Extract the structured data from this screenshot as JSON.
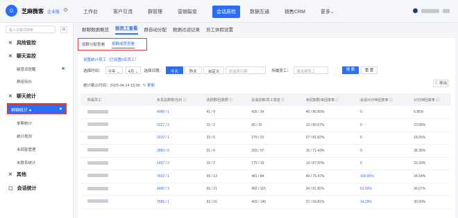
{
  "header": {
    "brand": "芝麻微客",
    "brand_tag": "企业版",
    "nav": [
      "工作台",
      "客户引流",
      "群管理",
      "营销裂变",
      "会话质检",
      "数据互通",
      "销售CRM",
      "更多⌄"
    ],
    "active_nav_index": 4
  },
  "sidebar": {
    "search_placeholder": "输入关键词搜索",
    "collapse": "⊟",
    "sections": [
      {
        "icon": "✕",
        "label": "风险管控",
        "caret": "⌄"
      },
      {
        "icon": "✕",
        "label": "聊天监控",
        "caret": "⌃"
      },
      {
        "icon": "✕",
        "label": "聊天统计",
        "caret": "⌃"
      },
      {
        "icon": "✕",
        "label": "其他",
        "caret": "⌄"
      },
      {
        "icon": "▢",
        "label": "会话统计",
        "caret": ""
      }
    ],
    "sub_items": [
      "敏感词提醒",
      "群组待办",
      "群聊统计",
      "单聊统计",
      "统计规则",
      "未回复管理",
      "未联系统计"
    ],
    "active_item": "群聊统计"
  },
  "main": {
    "page_tabs": [
      "群聊数据概览",
      "按员工查看",
      "群自动分配",
      "数据过滤记录",
      "员工休假设置"
    ],
    "active_page_tab": 1,
    "sub_tabs": [
      "按群分配查看",
      "按群成员查看"
    ],
    "active_sub_tab": 1,
    "setting_link": "设置统计员工（已设置0名员工）",
    "filter": {
      "time_label": "选择时间：",
      "year": "今年 ⌄",
      "month": "4月 ⌄",
      "date_label": "选择日期：",
      "date_options": [
        "今天",
        "昨天",
        "自定义"
      ],
      "date_placeholder": "请选择日期",
      "staff_label": "所属员工：",
      "staff_placeholder": "请选择员工"
    },
    "search_btn": "搜 索",
    "reset_btn": "重 置",
    "stat_time_label": "统计截止时间：",
    "stat_time": "2025-04-14 15:06",
    "refresh": "↻ 更新",
    "export_btn": "⇩ 导出",
    "table": {
      "headers": [
        "所属员工",
        "负责总群数/当日 ⓘ",
        "活跃群/回复群 ⓘ",
        "总消息数/员工发送 ⓘ",
        "未回复群/未回复率 ⓘ",
        "会话10分钟回复率 ⓘ",
        "10分钟回复率 ⓘ"
      ],
      "rows": [
        [
          "4090 / 1",
          "41 / 9",
          "439 / 34",
          "40 / 80.89%",
          "0",
          "6.85%"
        ],
        [
          "2227 / 2",
          "15 / 2",
          "95 / 15",
          "13 / 80.67%",
          "0",
          "23.08%"
        ],
        [
          "2032 / 1",
          "33 / 6",
          "279 / 22",
          "27 / 81.82%",
          "0",
          "18.05%"
        ],
        [
          "2880 / 0",
          "21 / 6",
          "333 / 97",
          "15 / 71.43%",
          "0",
          "38.35%"
        ],
        [
          "1437 / 2",
          "16 / 2",
          "179 / 16",
          "14 / 87.50%",
          "0",
          "33.33%"
        ],
        [
          "7932 / 1",
          "59 / 13",
          "481 / 84",
          "40 / 75.47%",
          "150.00%",
          "24.54%"
        ],
        [
          "4990 / 3",
          "55 / 21",
          "482 / 115",
          "34 / 61.82%",
          "61.50%",
          "36.07%"
        ],
        [
          "7585 / 1",
          "53 / 16",
          "493 / 140",
          "37 / 69.81%",
          "14.29%",
          "30.00%"
        ]
      ]
    }
  }
}
